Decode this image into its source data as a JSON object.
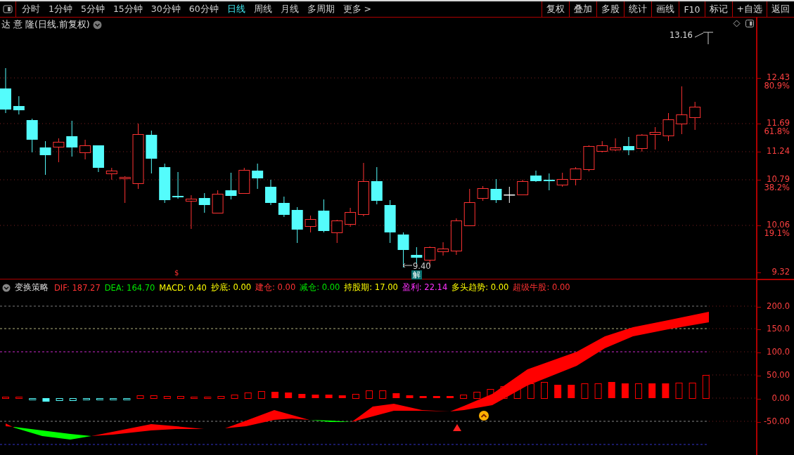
{
  "toolbar": {
    "tabs": [
      {
        "label": "分时",
        "selected": false
      },
      {
        "label": "1分钟",
        "selected": false
      },
      {
        "label": "5分钟",
        "selected": false
      },
      {
        "label": "15分钟",
        "selected": false
      },
      {
        "label": "30分钟",
        "selected": false
      },
      {
        "label": "60分钟",
        "selected": false
      },
      {
        "label": "日线",
        "selected": true
      },
      {
        "label": "周线",
        "selected": false
      },
      {
        "label": "月线",
        "selected": false
      },
      {
        "label": "多周期",
        "selected": false
      },
      {
        "label": "更多 >",
        "selected": false
      }
    ],
    "buttons": [
      "复权",
      "叠加",
      "多股",
      "统计",
      "画线",
      "F10",
      "标记",
      "+自选",
      "返回"
    ]
  },
  "chart": {
    "title": "达 意 隆(日线.前复权)",
    "high_label": "13.16",
    "low_label": "9.40",
    "signal_badge": "解",
    "signal_mark": "$",
    "price_axis": [
      {
        "price": "12.43",
        "pct": "80.9%"
      },
      {
        "price": "11.69",
        "pct": "61.8%"
      },
      {
        "price": "11.24"
      },
      {
        "price": "10.79",
        "pct": "38.2%"
      },
      {
        "price": "10.06",
        "pct": "19.1%"
      },
      {
        "price": "9.32"
      }
    ]
  },
  "indicator": {
    "name": "变换策略",
    "values": [
      {
        "text": "DIF: 187.27",
        "color": "#ff3232"
      },
      {
        "text": "DEA: 164.70",
        "color": "#00e600"
      },
      {
        "text": "MACD: 0.40",
        "color": "#ffff00"
      },
      {
        "text": "抄底: 0.00",
        "color": "#ffff00"
      },
      {
        "text": "建仓: 0.00",
        "color": "#ff3232"
      },
      {
        "text": "减仓: 0.00",
        "color": "#00e600"
      },
      {
        "text": "持股期: 17.00",
        "color": "#ffff00"
      },
      {
        "text": "盈利: 22.14",
        "color": "#ff32ff"
      },
      {
        "text": "多头趋势: 0.00",
        "color": "#ffff00"
      },
      {
        "text": "超级牛股: 0.00",
        "color": "#ff3232"
      }
    ],
    "axis": [
      "200.0",
      "150.0",
      "100.0",
      "50.00",
      "0.00",
      "-50.00"
    ]
  }
}
